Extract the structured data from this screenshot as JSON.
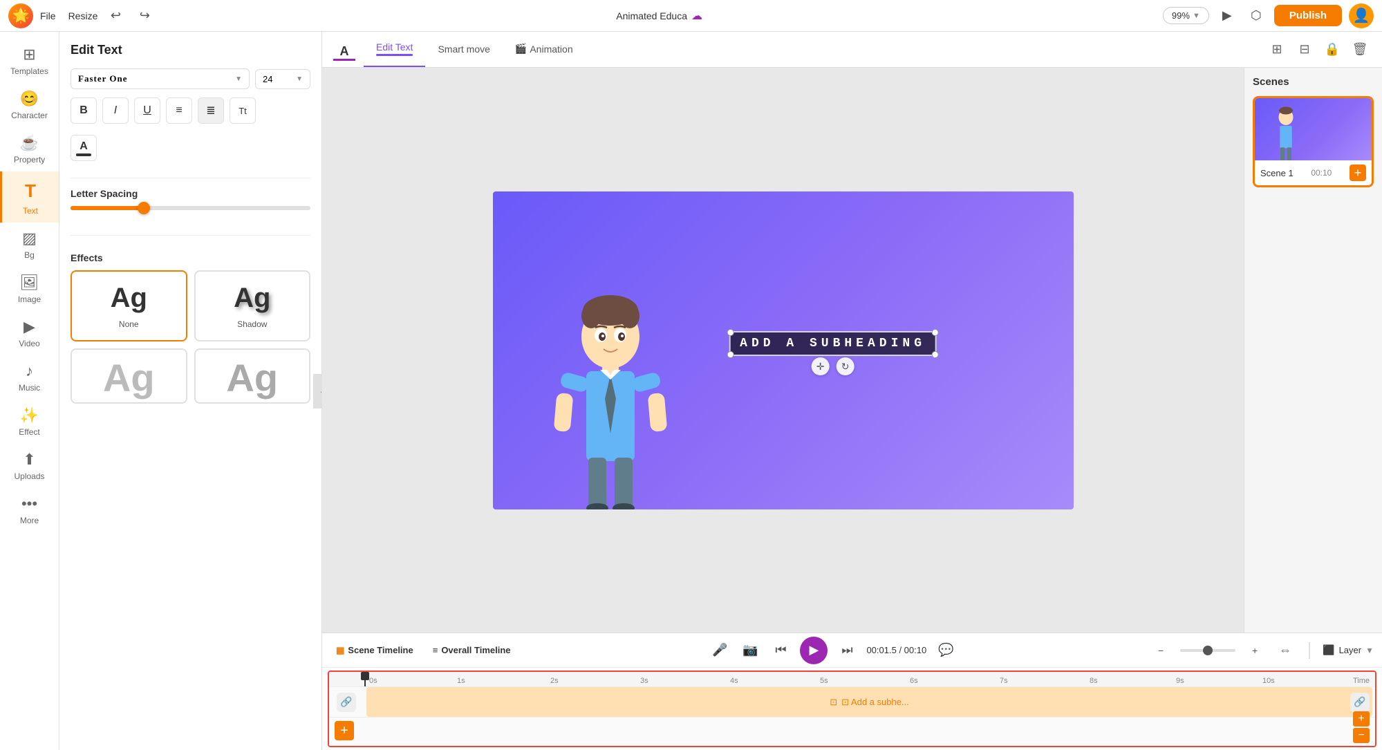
{
  "topbar": {
    "logo_text": "🌟",
    "menu": [
      "File",
      "Resize"
    ],
    "title": "Animated Educa",
    "cloud_icon": "☁",
    "zoom": "99%",
    "publish_label": "Publish",
    "undo_icon": "↩",
    "redo_icon": "↪",
    "play_icon": "▶",
    "share_icon": "⬡"
  },
  "left_nav": {
    "items": [
      {
        "id": "templates",
        "icon": "⊞",
        "label": "Templates"
      },
      {
        "id": "character",
        "icon": "😊",
        "label": "Character"
      },
      {
        "id": "property",
        "icon": "☕",
        "label": "Property"
      },
      {
        "id": "text",
        "icon": "T",
        "label": "Text",
        "active": true
      },
      {
        "id": "bg",
        "icon": "▨",
        "label": "Bg"
      },
      {
        "id": "image",
        "icon": "🖼",
        "label": "Image"
      },
      {
        "id": "video",
        "icon": "▶",
        "label": "Video"
      },
      {
        "id": "music",
        "icon": "♪",
        "label": "Music"
      },
      {
        "id": "effect",
        "icon": "✨",
        "label": "Effect"
      },
      {
        "id": "uploads",
        "icon": "⬆",
        "label": "Uploads"
      },
      {
        "id": "more",
        "icon": "•••",
        "label": "More"
      }
    ]
  },
  "edit_text_panel": {
    "title": "Edit Text",
    "font_name": "Faster One",
    "font_size": "24",
    "format_buttons": [
      {
        "id": "bold",
        "label": "B"
      },
      {
        "id": "italic",
        "label": "I"
      },
      {
        "id": "underline",
        "label": "U"
      },
      {
        "id": "list",
        "label": "≡"
      },
      {
        "id": "align",
        "label": "≣"
      },
      {
        "id": "transform",
        "label": "Tt"
      }
    ],
    "color_button": "A",
    "letter_spacing_label": "Letter Spacing",
    "slider_value": 30,
    "effects_label": "Effects",
    "effects": [
      {
        "id": "none",
        "label": "None",
        "selected": true
      },
      {
        "id": "shadow",
        "label": "Shadow",
        "selected": false
      },
      {
        "id": "outline",
        "label": "",
        "selected": false
      },
      {
        "id": "other",
        "label": "",
        "selected": false
      }
    ]
  },
  "toolbar": {
    "a_underline": "A",
    "tabs": [
      {
        "id": "edit-text",
        "label": "Edit Text",
        "active": true
      },
      {
        "id": "smart-move",
        "label": "Smart move",
        "active": false
      },
      {
        "id": "animation",
        "label": "Animation",
        "active": false
      }
    ],
    "icons": [
      "⊞",
      "⊟",
      "🔒",
      "🗑"
    ]
  },
  "canvas": {
    "textbox_content": "Add a Subheading",
    "textbox_display": "ADD A SUBHEADING"
  },
  "scenes_panel": {
    "title": "Scenes",
    "scene1_name": "Scene 1",
    "scene1_time": "00:10",
    "add_icon": "+"
  },
  "timeline": {
    "scene_timeline_label": "Scene Timeline",
    "overall_timeline_label": "Overall Timeline",
    "current_time": "00:01.5",
    "total_time": "00:10",
    "play_icon": "▶",
    "skip_back_icon": "⏮",
    "skip_fwd_icon": "⏭",
    "captions_icon": "💬",
    "layer_label": "Layer",
    "track_placeholder": "⊡ Add a subhe...",
    "ruler_marks": [
      "0s",
      "1s",
      "2s",
      "3s",
      "4s",
      "5s",
      "6s",
      "7s",
      "8s",
      "9s",
      "10s",
      "Time"
    ]
  }
}
